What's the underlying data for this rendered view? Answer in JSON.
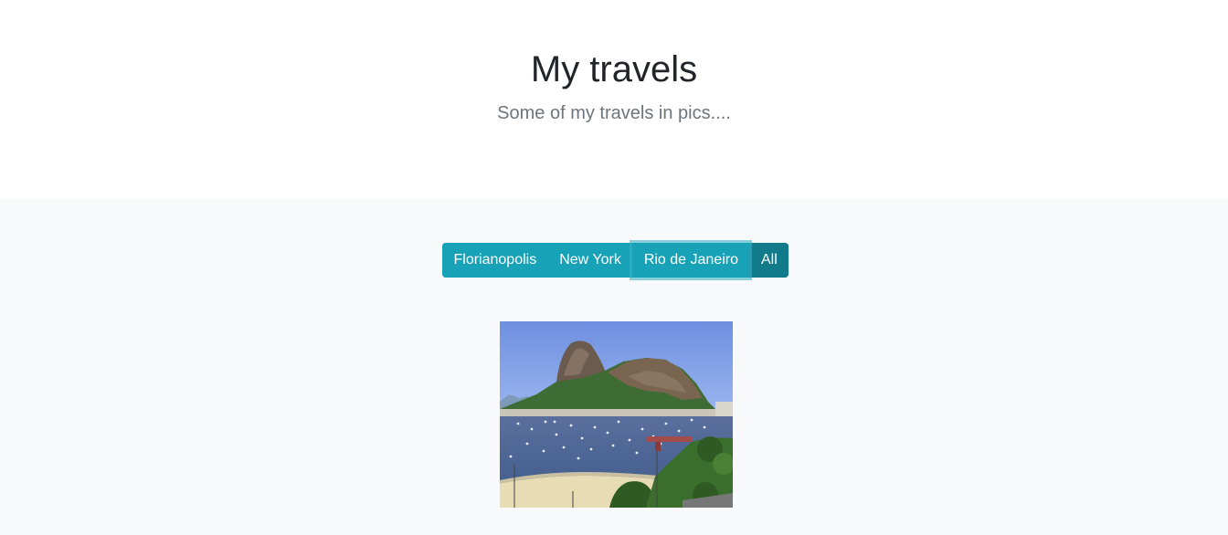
{
  "hero": {
    "title": "My travels",
    "subtitle": "Some of my travels in pics...."
  },
  "filters": [
    {
      "label": "Florianopolis"
    },
    {
      "label": "New York"
    },
    {
      "label": "Rio de Janeiro",
      "focused": true
    },
    {
      "label": "All",
      "active": true
    }
  ],
  "colors": {
    "accent": "#17a2b8",
    "accent_active": "#117a8b",
    "gallery_bg": "#f8f9fa"
  }
}
